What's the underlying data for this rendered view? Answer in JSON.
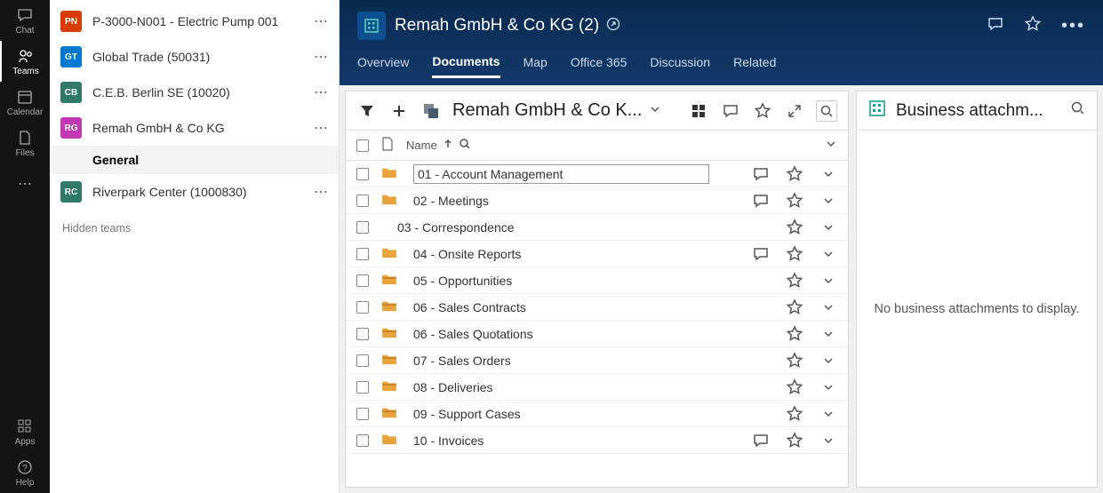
{
  "rail": {
    "chat": "Chat",
    "teams": "Teams",
    "calendar": "Calendar",
    "files": "Files",
    "apps": "Apps",
    "help": "Help"
  },
  "teams": {
    "items": [
      {
        "initials": "PN",
        "color": "#d83b01",
        "name": "P-3000-N001 - Electric Pump 001"
      },
      {
        "initials": "GT",
        "color": "#0078d4",
        "name": "Global Trade (50031)"
      },
      {
        "initials": "CB",
        "color": "#317a6a",
        "name": "C.E.B. Berlin SE (10020)"
      },
      {
        "initials": "RG",
        "color": "#c239b3",
        "name": "Remah GmbH & Co KG"
      },
      {
        "initials": "RC",
        "color": "#317a6a",
        "name": "Riverpark Center (1000830)"
      }
    ],
    "channel": "General",
    "hidden": "Hidden teams"
  },
  "header": {
    "title": "Remah GmbH & Co KG (2)",
    "tabs": [
      "Overview",
      "Documents",
      "Map",
      "Office 365",
      "Discussion",
      "Related"
    ],
    "activeTab": 1
  },
  "docs": {
    "breadcrumb": "Remah GmbH & Co K...",
    "nameCol": "Name",
    "rows": [
      {
        "name": "01 - Account Management",
        "type": "folder",
        "comment": true,
        "editing": true
      },
      {
        "name": "02 - Meetings",
        "type": "folder",
        "comment": true
      },
      {
        "name": "03 - Correspondence",
        "type": "none",
        "comment": false
      },
      {
        "name": "04 - Onsite Reports",
        "type": "folder",
        "comment": true
      },
      {
        "name": "05 - Opportunities",
        "type": "lib",
        "comment": false
      },
      {
        "name": "06 - Sales Contracts",
        "type": "lib",
        "comment": false
      },
      {
        "name": "06 - Sales Quotations",
        "type": "lib",
        "comment": false
      },
      {
        "name": "07 - Sales Orders",
        "type": "lib",
        "comment": false
      },
      {
        "name": "08 - Deliveries",
        "type": "lib",
        "comment": false
      },
      {
        "name": "09 - Support Cases",
        "type": "lib",
        "comment": false
      },
      {
        "name": "10 - Invoices",
        "type": "folder",
        "comment": true
      }
    ]
  },
  "attachments": {
    "title": "Business attachm...",
    "empty": "No business attachments to display."
  }
}
